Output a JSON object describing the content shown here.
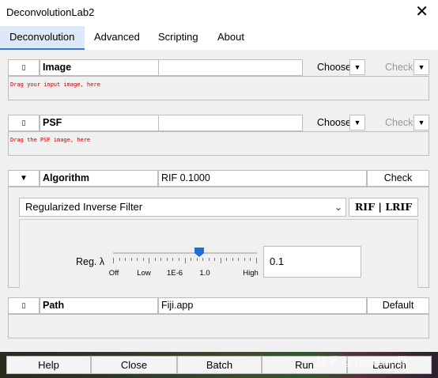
{
  "window": {
    "title": "DeconvolutionLab2",
    "close_glyph": "✕"
  },
  "tabs": [
    {
      "label": "Deconvolution",
      "active": true
    },
    {
      "label": "Advanced"
    },
    {
      "label": "Scripting"
    },
    {
      "label": "About"
    }
  ],
  "image": {
    "label": "Image",
    "value": "",
    "choose": "Choose",
    "check": "Check",
    "drop_hint": "Drag your input image, here"
  },
  "psf": {
    "label": "PSF",
    "value": "",
    "choose": "Choose",
    "check": "Check",
    "drop_hint": "Drag the PSF image, here"
  },
  "algorithm": {
    "label": "Algorithm",
    "value": "RIF 0.1000",
    "check": "Check",
    "selected": "Regularized Inverse Filter",
    "rif_button": "RIF | LRIF",
    "reg_label": "Reg. λ",
    "slider_labels": [
      "Off",
      "Low",
      "1E-6",
      "1.0",
      "High"
    ],
    "slider_position": 0.6,
    "reg_value": "0.1"
  },
  "path": {
    "label": "Path",
    "value": "Fiji.app",
    "default": "Default"
  },
  "buttons": {
    "help": "Help",
    "close": "Close",
    "batch": "Batch",
    "run": "Run",
    "launch": "Launch"
  },
  "watermark": "知乎 @Treasure探"
}
